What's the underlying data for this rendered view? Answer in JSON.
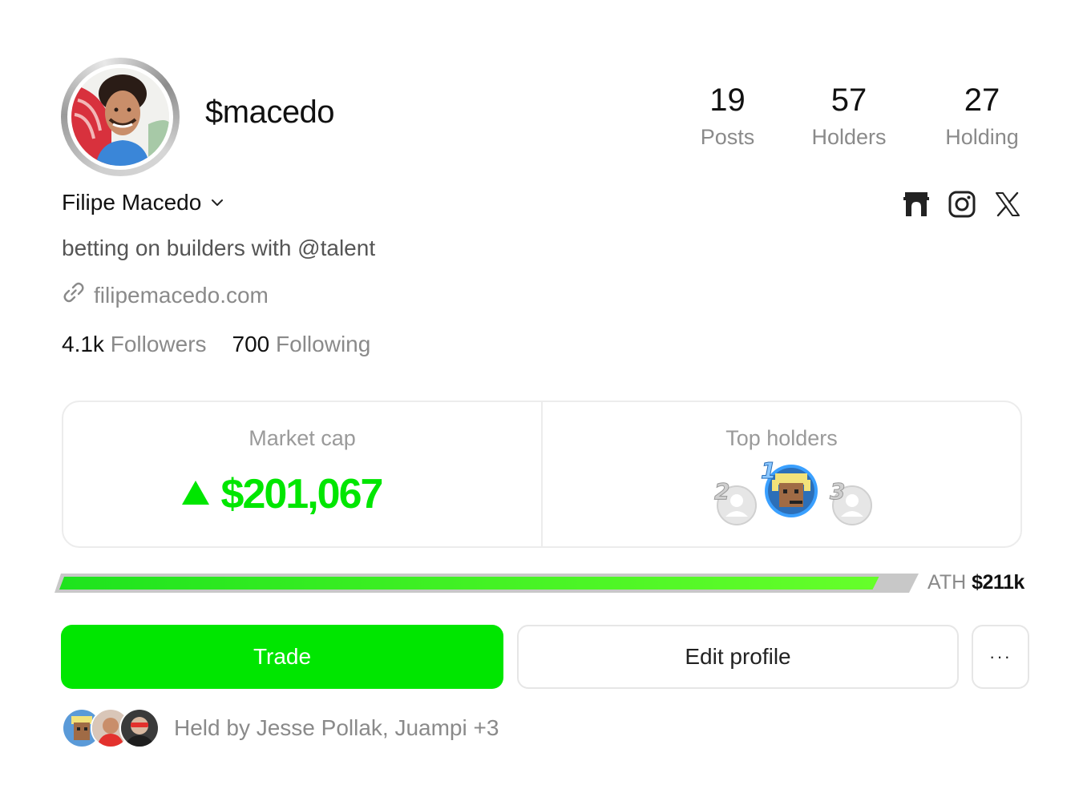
{
  "profile": {
    "handle": "$macedo",
    "name": "Filipe Macedo",
    "bio": "betting on builders with @talent",
    "website": "filipemacedo.com"
  },
  "stats": [
    {
      "value": "19",
      "label": "Posts"
    },
    {
      "value": "57",
      "label": "Holders"
    },
    {
      "value": "27",
      "label": "Holding"
    }
  ],
  "socials": [
    {
      "icon": "farcaster-icon"
    },
    {
      "icon": "instagram-icon"
    },
    {
      "icon": "x-icon"
    }
  ],
  "follow": {
    "followers_count": "4.1k",
    "followers_label": "Followers",
    "following_count": "700",
    "following_label": "Following"
  },
  "market": {
    "label": "Market cap",
    "value": "$201,067",
    "trend": "up",
    "progress_fraction": 0.95
  },
  "top_holders": {
    "label": "Top holders",
    "ranks": [
      "2",
      "1",
      "3"
    ]
  },
  "ath": {
    "label": "ATH",
    "value": "$211k"
  },
  "actions": {
    "trade": "Trade",
    "edit": "Edit profile",
    "more": "···"
  },
  "held_by": {
    "text": "Held by Jesse Pollak, Juampi +3"
  },
  "colors": {
    "accent_green": "#00e600",
    "muted_text": "#8a8a8a",
    "border": "#ececec"
  }
}
